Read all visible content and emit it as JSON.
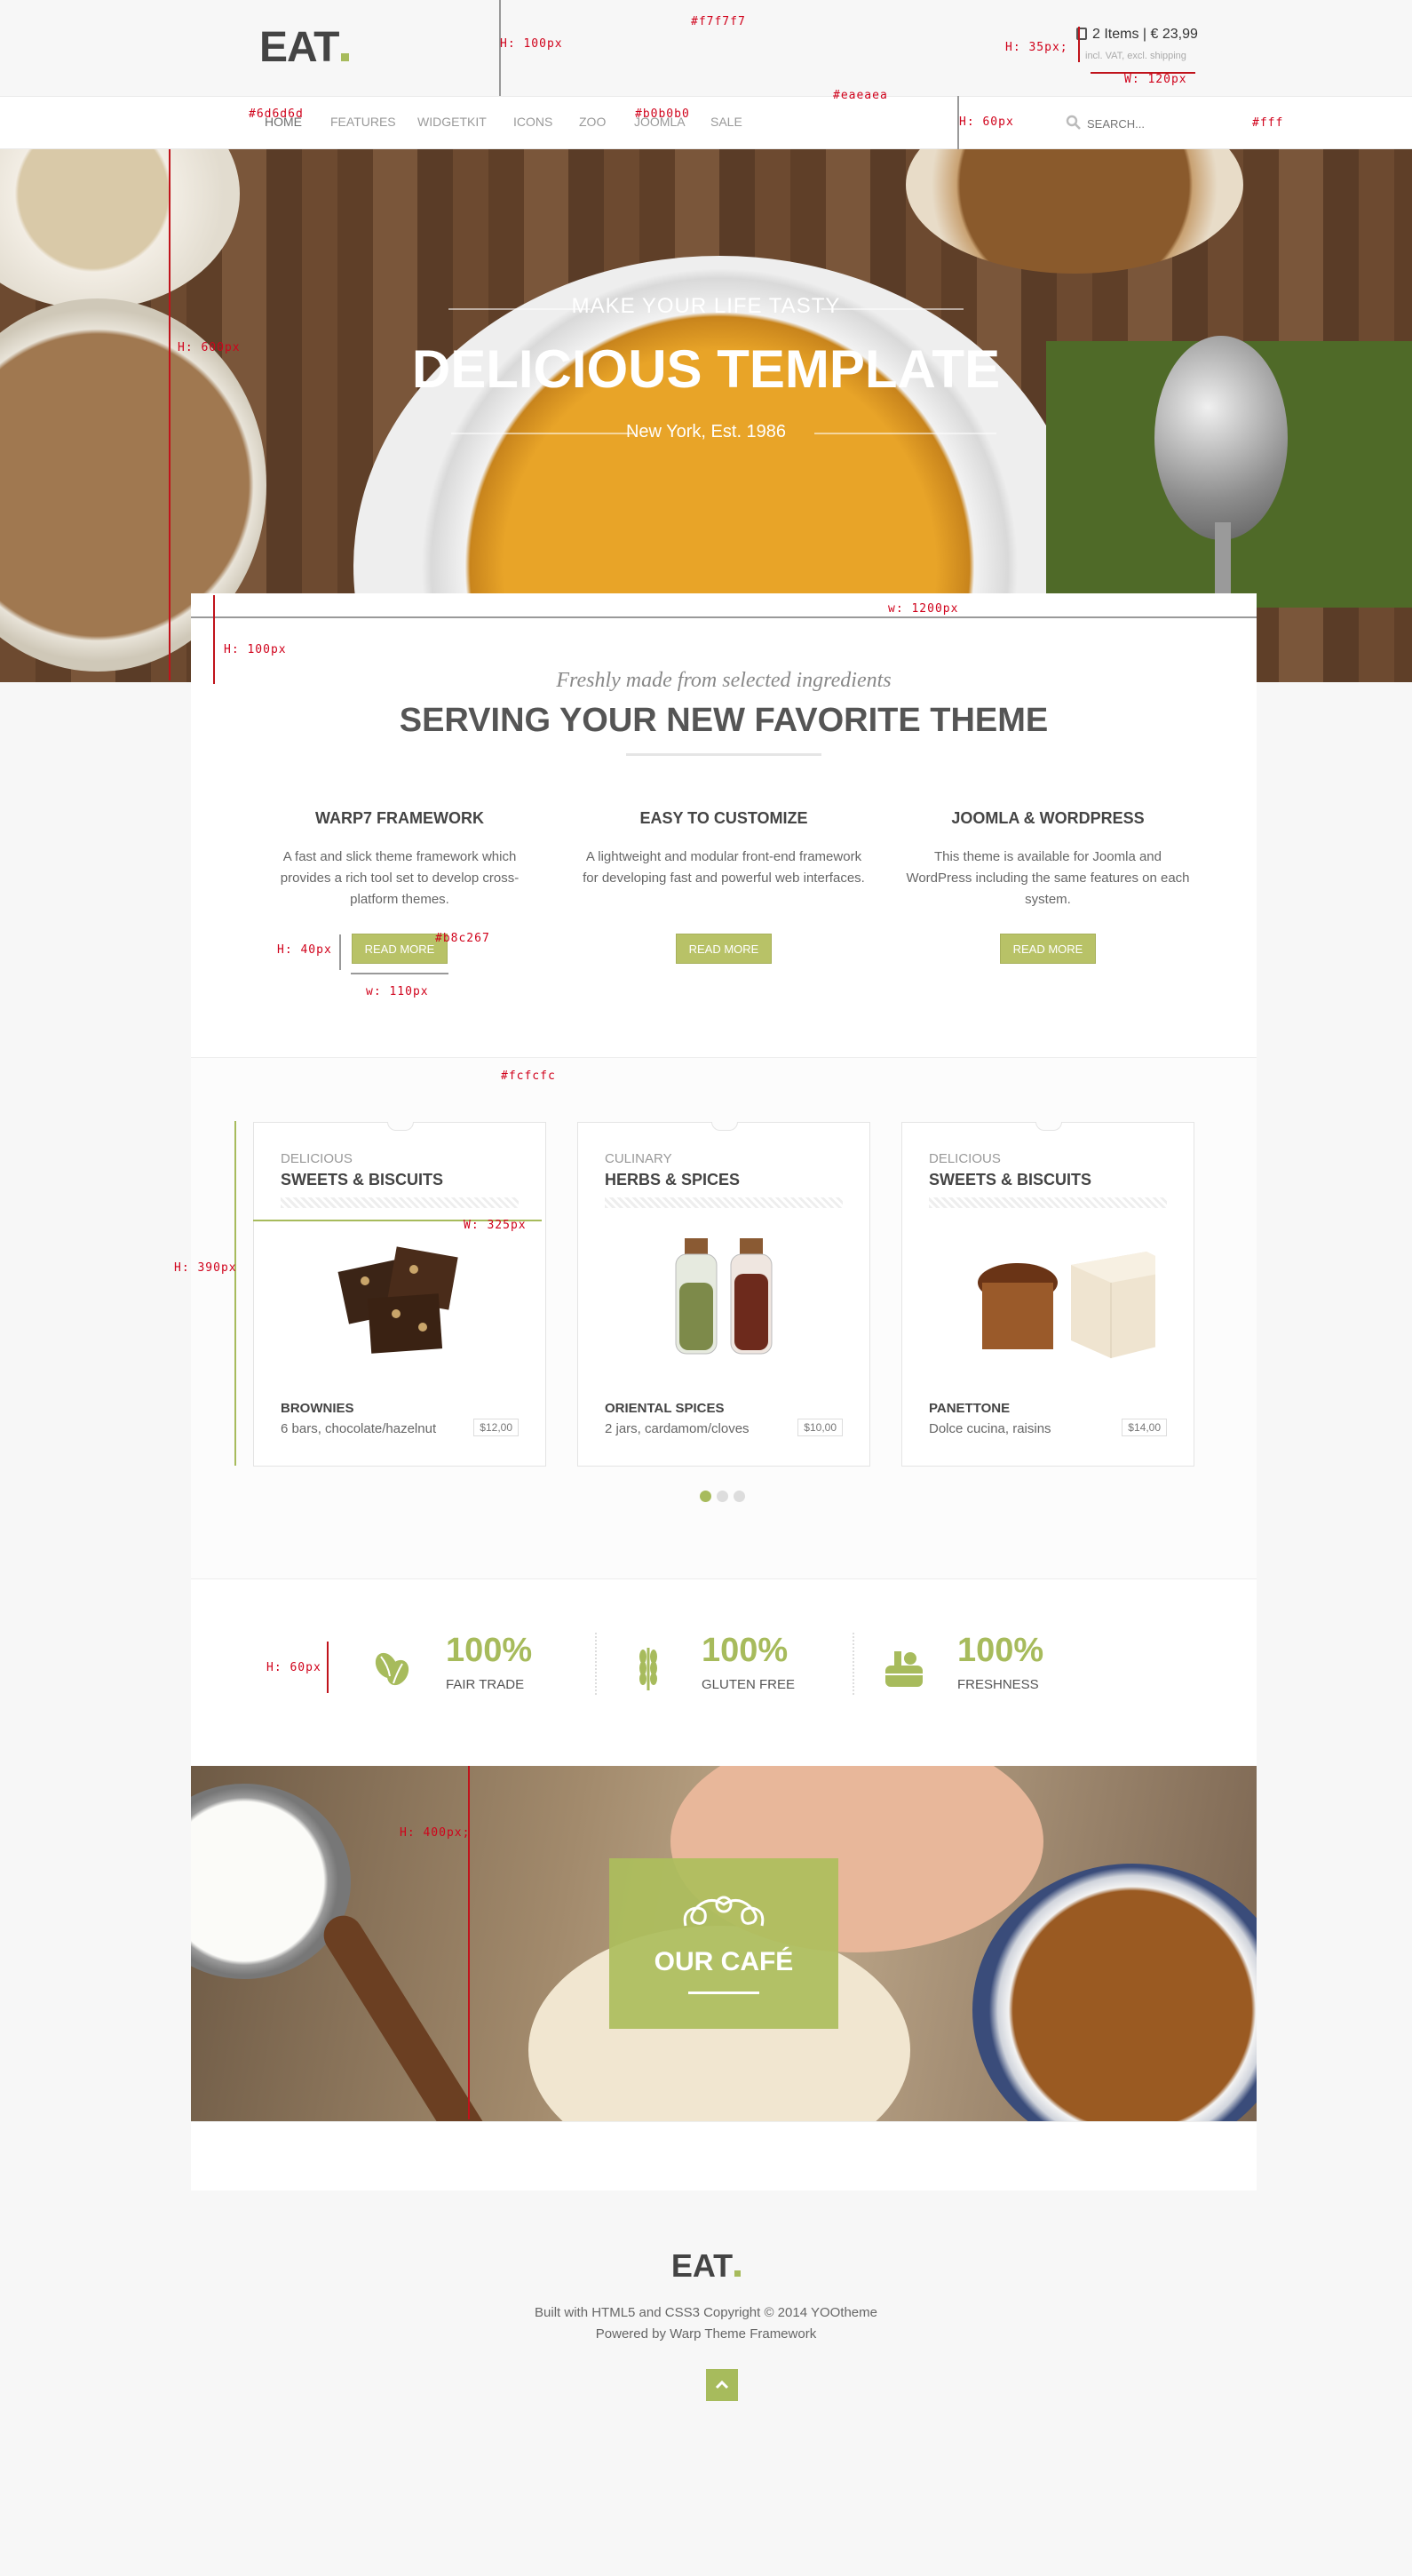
{
  "brand": {
    "logo": "EAT",
    "accent_color": "#a7bb5c"
  },
  "cart": {
    "summary": "2 Items | € 23,99",
    "sub": "incl. VAT, excl. shipping"
  },
  "nav": {
    "items": [
      "Home",
      "Features",
      "Widgetkit",
      "Icons",
      "Zoo",
      "Joomla",
      "Sale"
    ],
    "active": "Home"
  },
  "search": {
    "placeholder": "SEARCH..."
  },
  "hero": {
    "kicker": "MAKE YOUR LIFE TASTY",
    "title": "DELICIOUS TEMPLATE",
    "sub": "New York, Est. 1986"
  },
  "intro": {
    "kicker": "Freshly made from selected ingredients",
    "title": "SERVING YOUR NEW FAVORITE THEME"
  },
  "features": [
    {
      "title": "WARP7 FRAMEWORK",
      "text": "A fast and slick theme framework which provides a rich tool set to develop cross-platform themes.",
      "button": "READ MORE"
    },
    {
      "title": "EASY TO CUSTOMIZE",
      "text": "A lightweight and modular front-end framework for developing fast and powerful web interfaces.",
      "button": "READ MORE"
    },
    {
      "title": "JOOMLA & WORDPRESS",
      "text": "This theme is available for Joomla and WordPress including the same features on each system.",
      "button": "READ MORE"
    }
  ],
  "products": [
    {
      "category": "DELICIOUS",
      "title": "SWEETS & BISCUITS",
      "name": "BROWNIES",
      "desc": "6 bars, chocolate/hazelnut",
      "price": "$12,00",
      "icon": "brownies-image"
    },
    {
      "category": "CULINARY",
      "title": "HERBS & SPICES",
      "name": "ORIENTAL SPICES",
      "desc": "2 jars, cardamom/cloves",
      "price": "$10,00",
      "icon": "spice-jars-image"
    },
    {
      "category": "DELICIOUS",
      "title": "SWEETS & BISCUITS",
      "name": "PANETTONE",
      "desc": "Dolce cucina, raisins",
      "price": "$14,00",
      "icon": "panettone-image"
    }
  ],
  "stats": [
    {
      "value": "100%",
      "label": "FAIR TRADE",
      "icon": "coffee-beans-icon"
    },
    {
      "value": "100%",
      "label": "GLUTEN FREE",
      "icon": "wheat-icon"
    },
    {
      "value": "100%",
      "label": "FRESHNESS",
      "icon": "basket-icon"
    }
  ],
  "cafe": {
    "title": "OUR CAFÉ"
  },
  "footer": {
    "logo": "EAT",
    "line1": "Built with HTML5 and CSS3 Copyright © 2014 YOOtheme",
    "line2": "Powered by Warp Theme Framework"
  },
  "annotations": {
    "top_bg": "#f7f7f7",
    "top_h": "H: 100px",
    "cart_h": "H: 35px;",
    "cart_w": "W: 120px",
    "nav_bg": "#6d6d6d",
    "nav_color2": "#b0b0b0",
    "nav_border": "#eaeaea",
    "nav_h": "H: 60px",
    "nav_fff": "#fff",
    "hero_h": "H: 600px",
    "main_w": "w: 1200px",
    "main_h": "H: 100px",
    "btn_h": "H: 40px",
    "btn_color": "#b8c267",
    "btn_w": "w: 110px",
    "band_bg": "#fcfcfc",
    "card_h": "H: 390px",
    "card_w": "W: 325px",
    "stat_h": "H: 60px",
    "cafe_h": "H: 400px;"
  }
}
